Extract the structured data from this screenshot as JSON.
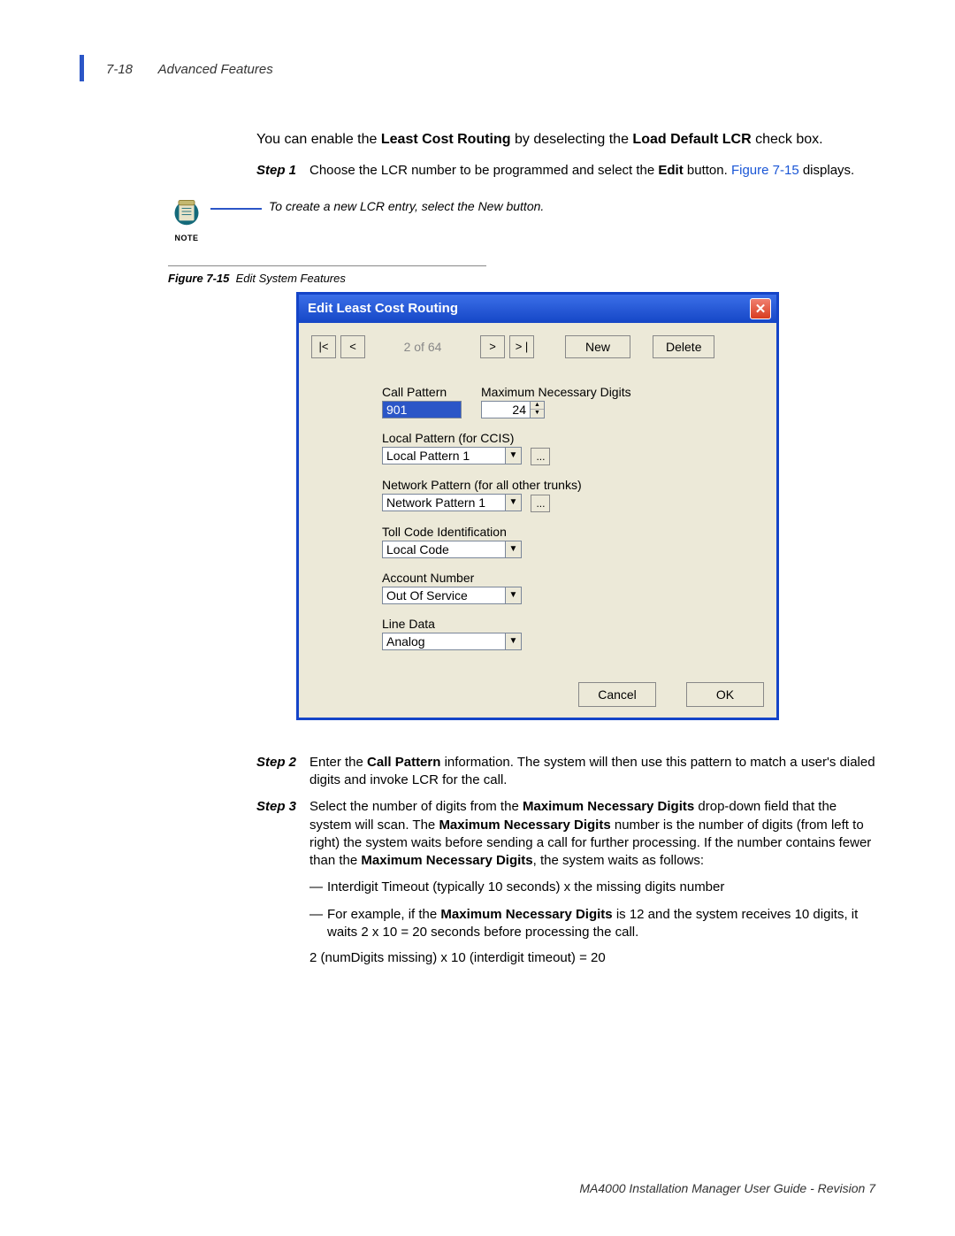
{
  "header": {
    "page_num": "7-18",
    "section": "Advanced Features"
  },
  "intro": {
    "pre": "You can enable the ",
    "b1": "Least Cost Routing",
    "mid": " by deselecting the ",
    "b2": "Load Default LCR",
    "post": " check box."
  },
  "step1": {
    "label": "Step 1",
    "t1": "Choose the LCR number to be programmed and select the ",
    "b1": "Edit",
    "t2": " button. ",
    "link": "Figure 7-15",
    "t3": " displays."
  },
  "note": {
    "label": "NOTE",
    "text": "To create a new LCR entry, select the New button."
  },
  "figure": {
    "num": "Figure 7-15",
    "title": "Edit System Features"
  },
  "dialog": {
    "title": "Edit Least Cost Routing",
    "nav": {
      "first": "|<",
      "prev": "<",
      "counter": "2 of 64",
      "next": ">",
      "last": "> |",
      "new": "New",
      "delete": "Delete"
    },
    "labels": {
      "call_pattern": "Call Pattern",
      "max_digits": "Maximum Necessary Digits",
      "local_pattern": "Local Pattern (for CCIS)",
      "network_pattern": "Network Pattern (for all other trunks)",
      "toll_code": "Toll Code Identification",
      "account": "Account Number",
      "line_data": "Line Data"
    },
    "values": {
      "call_pattern": "901",
      "max_digits": "24",
      "local_pattern": "Local Pattern 1",
      "network_pattern": "Network Pattern 1",
      "toll_code": "Local Code",
      "account": "Out Of Service",
      "line_data": "Analog"
    },
    "buttons": {
      "ellipsis": "...",
      "cancel": "Cancel",
      "ok": "OK"
    }
  },
  "step2": {
    "label": "Step 2",
    "t1": "Enter the ",
    "b1": "Call Pattern",
    "t2": " information. The system will then use this pattern to match a user's dialed digits and invoke LCR for the call."
  },
  "step3": {
    "label": "Step 3",
    "t1": "Select the number of digits from the ",
    "b1": "Maximum Necessary Digits",
    "t2": " drop-down field that the system will scan. The ",
    "b2": "Maximum Necessary Digits",
    "t3": " number is the number of digits (from left to right) the system waits before sending a call for further processing. If the number contains fewer than the ",
    "b3": "Maximum Necessary Digits",
    "t4": ", the system waits as follows:"
  },
  "sublist": {
    "i1": "Interdigit Timeout (typically 10 seconds) x the missing digits number",
    "i2a": "For example, if the ",
    "i2b": "Maximum Necessary Digits",
    "i2c": " is 12 and the system receives 10 digits, it waits 2 x 10 = 20 seconds before processing the call."
  },
  "calc": "2 (numDigits missing) x 10 (interdigit timeout) = 20",
  "footer": "MA4000 Installation Manager User Guide - Revision 7"
}
